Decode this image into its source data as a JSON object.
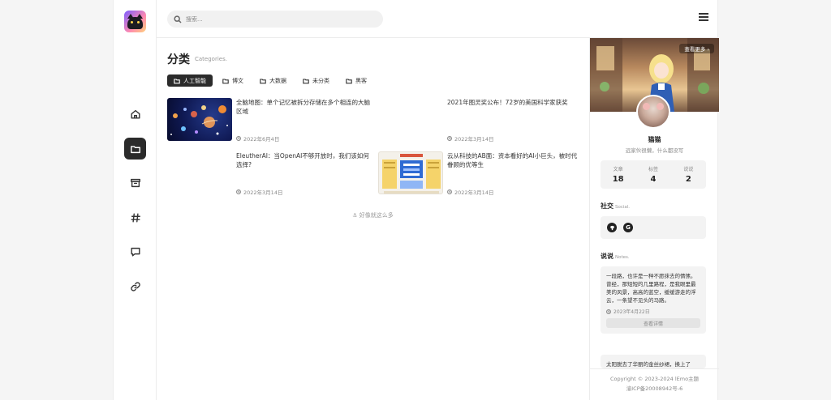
{
  "search": {
    "placeholder": "搜索..."
  },
  "page": {
    "title": "分类",
    "subtitle": "Categories."
  },
  "categories": [
    {
      "label": "人工智能",
      "active": true
    },
    {
      "label": "博文",
      "active": false
    },
    {
      "label": "大数据",
      "active": false
    },
    {
      "label": "未分类",
      "active": false
    },
    {
      "label": "黑客",
      "active": false
    }
  ],
  "posts": [
    {
      "title": "全脑地图：单个记忆被拆分存储在多个相连的大脑区域",
      "date": "2022年6月4日",
      "thumb": "planets"
    },
    {
      "title": "2021年图灵奖公布！72岁的美国科学家获奖",
      "date": "2022年3月14日",
      "thumb": "none"
    },
    {
      "title": "EleutherAI：当OpenAI不够开放时，我们该如何选择?",
      "date": "2022年3月14日",
      "thumb": "none"
    },
    {
      "title": "云从科技的AB面：资本看好的AI小巨头，被时代眷顾的优等生",
      "date": "2022年3月14日",
      "thumb": "infographic"
    }
  ],
  "end_text": "⚓ 好像就这么多",
  "sidebar": {
    "more_label": "查看更多 ›",
    "user": {
      "name": "猫猫",
      "bio": "远家伙很懒，什么都没写"
    },
    "stats": [
      {
        "label": "文章",
        "value": "18"
      },
      {
        "label": "标签",
        "value": "4"
      },
      {
        "label": "说说",
        "value": "2"
      }
    ],
    "social": {
      "title": "社交",
      "subtitle": "Social.",
      "icons": [
        "github-icon",
        "g-icon"
      ],
      "g_letter": "G"
    },
    "notes": {
      "title": "说说",
      "subtitle": "Notes.",
      "items": [
        {
          "text": "一段路，也许是一种不愿抹去的情愫。曾经，那短短的几里路程，是我眼里最美的风景，高高的蓝空，缓缓游走的浮云，一条望不见头的马路。",
          "date": "2023年4月22日",
          "button": "查看详情"
        },
        {
          "text": "太阳脱去了华丽的金丝纱裙，换上了"
        }
      ]
    },
    "footer": {
      "line1": "Copyright © 2023-2024 lEmo主题",
      "line2": "渝ICP备20008942号-6"
    }
  },
  "colors": {
    "accent": "#2b2b2b",
    "panel": "#f3f3f3"
  }
}
